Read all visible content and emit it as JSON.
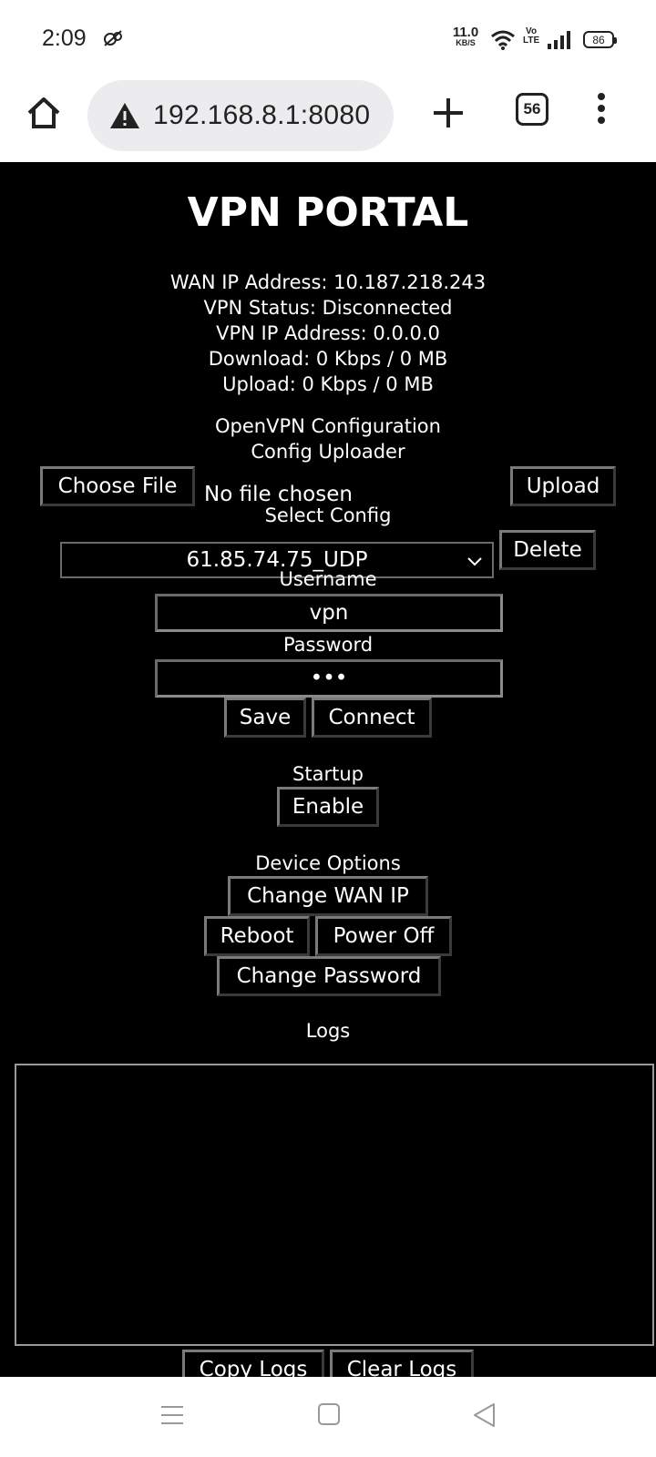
{
  "status_bar": {
    "time": "2:09",
    "net_speed": "11.0",
    "net_unit": "KB/S",
    "volte_top": "Vo",
    "volte_bottom": "LTE",
    "battery": "86"
  },
  "browser": {
    "url": "192.168.8.1:8080",
    "tab_count": "56"
  },
  "portal": {
    "title": "VPN PORTAL",
    "info": {
      "wan_ip": "WAN IP Address: 10.187.218.243",
      "vpn_status": "VPN Status: Disconnected",
      "vpn_ip": "VPN IP Address: 0.0.0.0",
      "download": "Download: 0 Kbps / 0 MB",
      "upload": "Upload: 0 Kbps / 0 MB"
    },
    "openvpn_heading": "OpenVPN Configuration",
    "uploader_heading": "Config Uploader",
    "choose_file_label": "Choose File",
    "file_status": "No file chosen",
    "upload_label": "Upload",
    "select_config_label": "Select Config",
    "selected_config": "61.85.74.75_UDP",
    "delete_label": "Delete",
    "username_label": "Username",
    "username_value": "vpn",
    "password_label": "Password",
    "password_value": "•••",
    "save_label": "Save",
    "connect_label": "Connect",
    "startup_heading": "Startup",
    "enable_label": "Enable",
    "device_options_heading": "Device Options",
    "change_wan_ip_label": "Change WAN IP",
    "reboot_label": "Reboot",
    "power_off_label": "Power Off",
    "change_password_label": "Change Password",
    "logs_heading": "Logs",
    "logs_content": "",
    "copy_logs_label": "Copy Logs",
    "clear_logs_label": "Clear Logs"
  },
  "icons": {
    "home": "home-icon",
    "warning": "warning-icon",
    "new_tab": "plus-icon",
    "menu": "kebab-menu-icon",
    "wifi": "wifi-icon",
    "signal": "signal-icon",
    "nav_menu": "recent-apps-icon",
    "nav_home": "square-home-icon",
    "nav_back": "triangle-back-icon"
  }
}
